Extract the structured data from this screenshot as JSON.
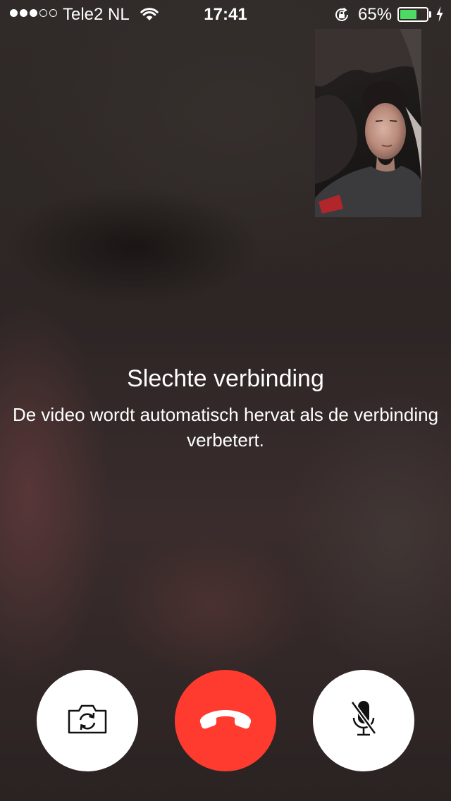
{
  "status_bar": {
    "signal_bars_filled": 3,
    "signal_bars_total": 5,
    "carrier": "Tele2 NL",
    "time": "17:41",
    "battery_percent": "65%",
    "battery_level": 0.65,
    "icons": [
      "wifi-icon",
      "rotation-lock-icon",
      "battery-icon",
      "charging-icon"
    ],
    "battery_color": "#4cd964"
  },
  "message": {
    "title": "Slechte verbinding",
    "line1": "De video wordt automatisch hervat als de verbinding",
    "line2": "verbetert."
  },
  "controls": {
    "flip_camera": {
      "icon": "camera-flip-icon"
    },
    "end_call": {
      "icon": "phone-hangup-icon",
      "color": "#ff3b30"
    },
    "mute": {
      "icon": "microphone-muted-icon"
    }
  }
}
